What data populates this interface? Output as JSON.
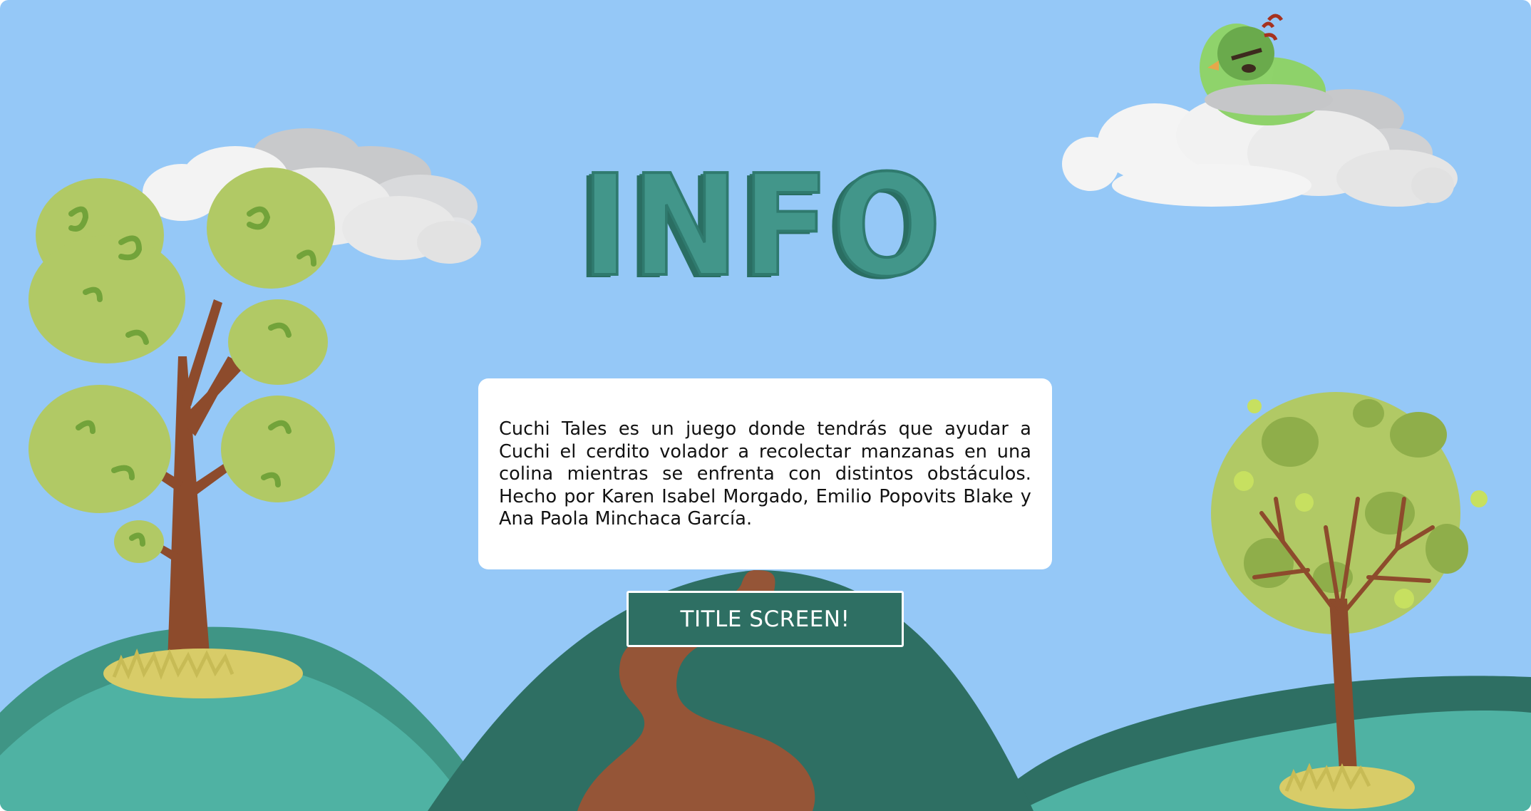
{
  "screen": {
    "title": "INFO",
    "description": "Cuchi Tales es un juego donde tendrás que ayudar a Cuchi el cerdito volador a recolectar manzanas en una colina mientras se enfrenta con distintos obstáculos. Hecho por Karen Isabel Morgado, Emilio Popovits Blake y Ana Paola Minchaca García.",
    "button_label": "TITLE SCREEN!"
  },
  "scene": {
    "background": "sky-with-hills",
    "decorations": [
      "cloud-left",
      "cloud-right",
      "angry-bird-on-cloud",
      "tree-left",
      "tree-right",
      "hills",
      "dirt-path",
      "grass-tufts"
    ]
  },
  "colors": {
    "sky": "#95c8f7",
    "title": "#42968a",
    "hill_dark": "#2e6f63",
    "hill_light": "#4fb2a3",
    "path": "#955537",
    "foliage": "#b1c965",
    "trunk": "#8d4b2c"
  }
}
